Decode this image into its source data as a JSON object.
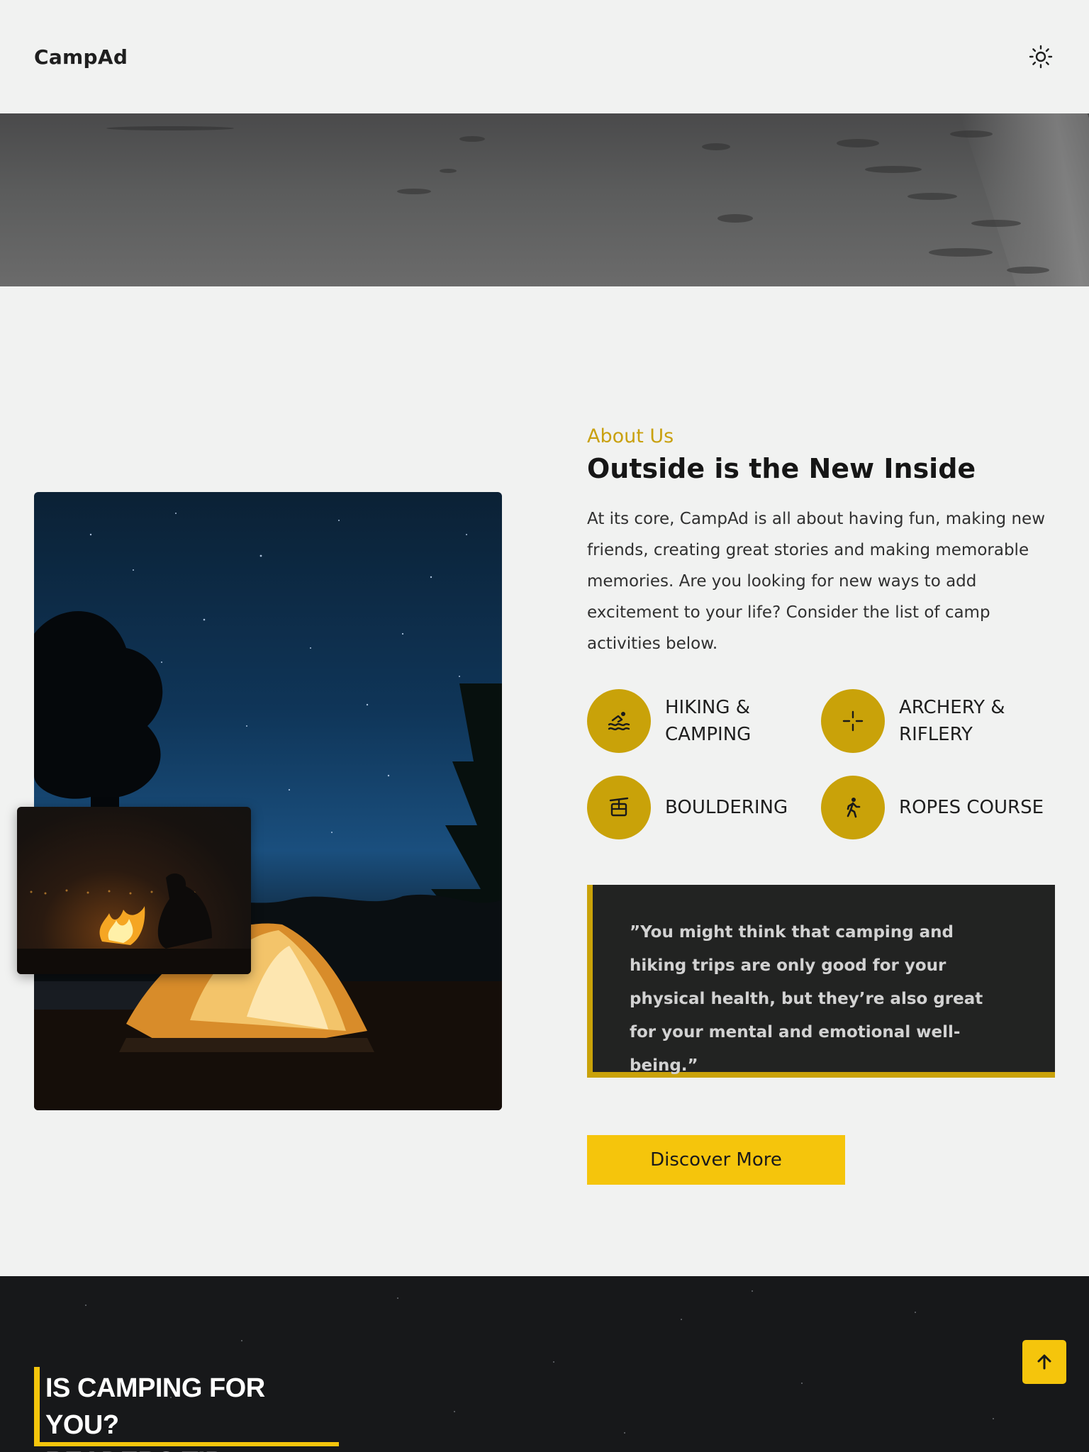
{
  "header": {
    "brand": "CampAd",
    "theme_icon": "sun-icon"
  },
  "about": {
    "eyebrow": "About Us",
    "title": "Outside is the New Inside",
    "body": "At its core, CampAd is all about having fun, making new friends, creating great stories and making memorable memories. Are you looking for new ways to add excitement to your life? Consider the list of camp activities below.",
    "activities": [
      {
        "icon": "swimming-icon",
        "label_line1": "HIKING &",
        "label_line2": "CAMPING"
      },
      {
        "icon": "crosshair-icon",
        "label_line1": "ARCHERY &",
        "label_line2": "RIFLERY"
      },
      {
        "icon": "cable-car-icon",
        "label_line1": "BOULDERING",
        "label_line2": ""
      },
      {
        "icon": "hiker-icon",
        "label_line1": "ROPES COURSE",
        "label_line2": ""
      }
    ],
    "quote": "”You might think that camping and hiking trips are only good for your physical health, but they’re also great for your mental and emotional well-being.”",
    "cta_label": "Discover More"
  },
  "tips": {
    "heading_line1": "IS CAMPING FOR YOU?",
    "heading_line2": "READERS TIP"
  },
  "scroll_top_icon": "arrow-up-icon",
  "colors": {
    "accent": "#f5c50c",
    "accent_dark": "#c9a209",
    "background": "#f1f2f1",
    "dark": "#222322"
  }
}
